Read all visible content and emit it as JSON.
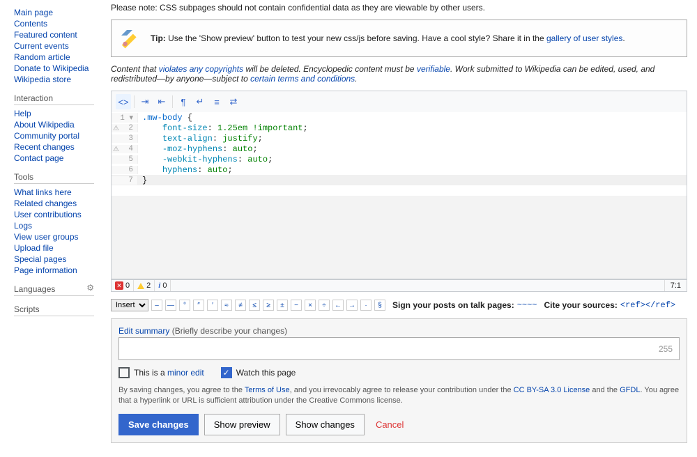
{
  "sidebar": {
    "main_items": [
      "Main page",
      "Contents",
      "Featured content",
      "Current events",
      "Random article",
      "Donate to Wikipedia",
      "Wikipedia store"
    ],
    "interaction_heading": "Interaction",
    "interaction_items": [
      "Help",
      "About Wikipedia",
      "Community portal",
      "Recent changes",
      "Contact page"
    ],
    "tools_heading": "Tools",
    "tools_items": [
      "What links here",
      "Related changes",
      "User contributions",
      "Logs",
      "View user groups",
      "Upload file",
      "Special pages",
      "Page information"
    ],
    "languages_heading": "Languages",
    "scripts_heading": "Scripts"
  },
  "warning_note": "Please note: CSS subpages should not contain confidential data as they are viewable by other users.",
  "tip": {
    "prefix": "Tip:",
    "text1": " Use the 'Show preview' button to test your new css/js before saving. Have a cool style? Share it in the ",
    "link": "gallery of user styles",
    "text2": "."
  },
  "copyright": {
    "t1": "Content that ",
    "l1": "violates any copyrights",
    "t2": " will be deleted. Encyclopedic content must be ",
    "l2": "verifiable",
    "t3": ". Work submitted to Wikipedia can be edited, used, and redistributed—by anyone—subject to ",
    "l3": "certain terms and conditions",
    "t4": "."
  },
  "code": {
    "line1_sel": ".mw-body",
    "line1_brace": " {",
    "line2_prop": "font-size",
    "line2_val": "1.25em",
    "line2_imp": "!important",
    "line3_prop": "text-align",
    "line3_val": "justify",
    "line4_prop": "-moz-hyphens",
    "line4_val": "auto",
    "line5_prop": "-webkit-hyphens",
    "line5_val": "auto",
    "line6_prop": "hyphens",
    "line6_val": "auto",
    "line7": "}"
  },
  "status": {
    "errors": "0",
    "warnings": "2",
    "info": "0",
    "cursor": "7:1"
  },
  "chartoolbar": {
    "insert_label": "Insert",
    "chars": [
      "–",
      "—",
      "°",
      "″",
      "′",
      "≈",
      "≠",
      "≤",
      "≥",
      "±",
      "−",
      "×",
      "÷",
      "←",
      "→",
      "·",
      "§"
    ],
    "sign_label": "Sign your posts on talk pages:",
    "sign_code": "~~~~",
    "cite_label": "Cite your sources:",
    "cite_code": "<ref></ref>"
  },
  "summary": {
    "label": "Edit summary",
    "hint": "(Briefly describe your changes)",
    "charcount": "255",
    "minor_text": "This is a ",
    "minor_link": "minor edit",
    "watch_text": "Watch this page"
  },
  "legal": {
    "t1": "By saving changes, you agree to the ",
    "l1": "Terms of Use",
    "t2": ", and you irrevocably agree to release your contribution under the ",
    "l2": "CC BY-SA 3.0 License",
    "t3": " and the ",
    "l3": "GFDL",
    "t4": ". You agree that a hyperlink or URL is sufficient attribution under the Creative Commons license."
  },
  "buttons": {
    "save": "Save changes",
    "preview": "Show preview",
    "diff": "Show changes",
    "cancel": "Cancel"
  }
}
